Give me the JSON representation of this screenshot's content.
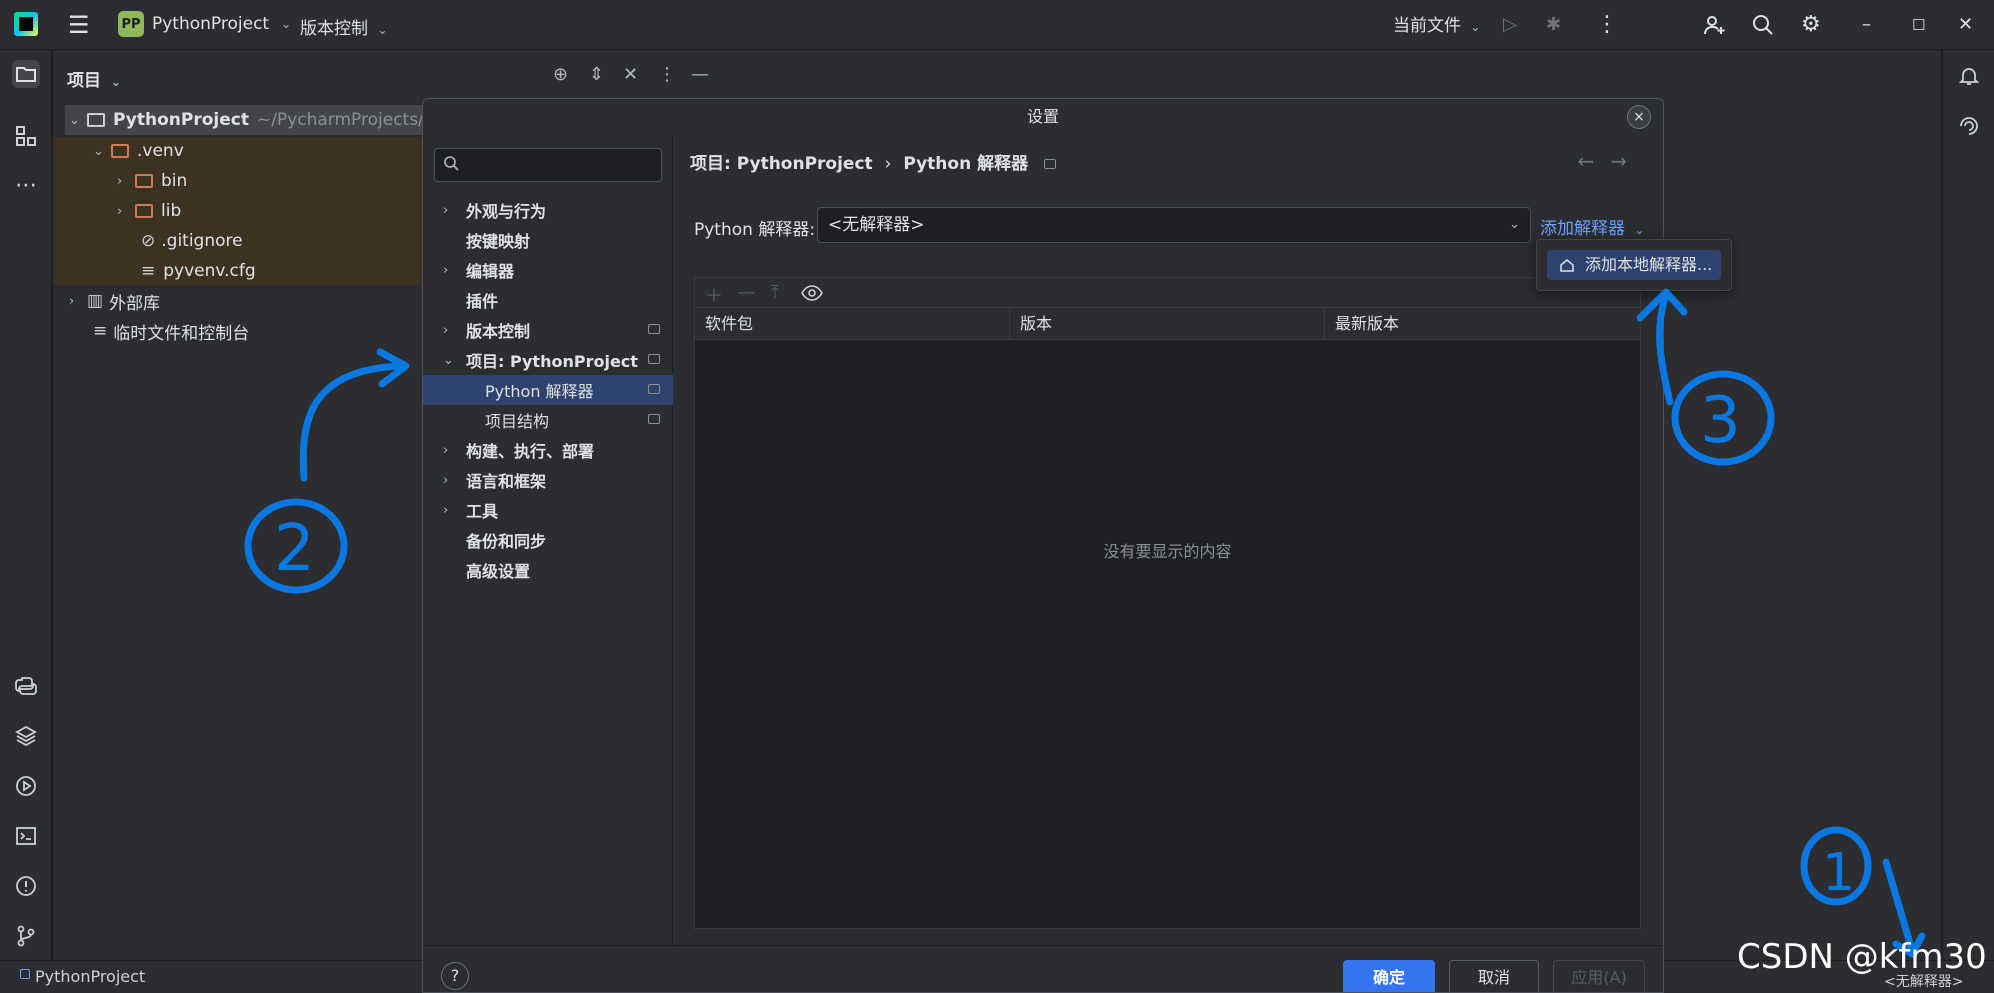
{
  "titlebar": {
    "project_badge": "PP",
    "project_name": "PythonProject",
    "vcs": "版本控制",
    "run_config": "当前文件"
  },
  "project_panel": {
    "title": "项目",
    "tree": {
      "root_name": "PythonProject",
      "root_path": "~/PycharmProjects/Pyt",
      "venv": ".venv",
      "bin": "bin",
      "lib": "lib",
      "gitignore": ".gitignore",
      "pyvenv": "pyvenv.cfg",
      "external_libs": "外部库",
      "scratches": "临时文件和控制台"
    }
  },
  "dialog": {
    "title": "设置",
    "close": "×",
    "nav": {
      "appearance": "外观与行为",
      "keymap": "按键映射",
      "editor": "编辑器",
      "plugins": "插件",
      "vcs": "版本控制",
      "project": "项目: PythonProject",
      "python_interpreter": "Python 解释器",
      "project_structure": "项目结构",
      "build": "构建、执行、部署",
      "languages": "语言和框架",
      "tools": "工具",
      "backup": "备份和同步",
      "advanced": "高级设置"
    },
    "breadcrumb": {
      "part1": "项目: PythonProject",
      "sep": "›",
      "part2": "Python 解释器"
    },
    "interpreter_label": "Python 解释器:",
    "interpreter_value": "<无解释器>",
    "add_interpreter": "添加解释器",
    "popup_item": "添加本地解释器...",
    "table": {
      "columns": [
        "软件包",
        "版本",
        "最新版本"
      ],
      "empty": "没有要显示的内容"
    },
    "footer": {
      "help": "?",
      "ok": "确定",
      "cancel": "取消",
      "apply": "应用(A)"
    }
  },
  "statusbar": {
    "project": "PythonProject",
    "interpreter": "<无解释器>"
  },
  "watermark": "CSDN @kfm30",
  "annotations": [
    "1",
    "2",
    "3"
  ]
}
